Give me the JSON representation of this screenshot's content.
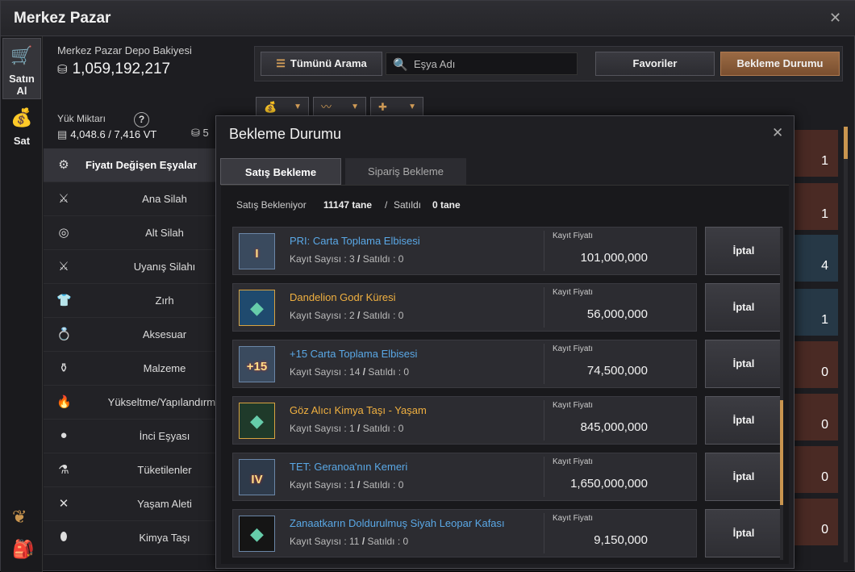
{
  "window": {
    "title": "Merkez Pazar"
  },
  "vtabs": [
    {
      "label": "Satın Al",
      "icon": "cart-icon"
    },
    {
      "label": "Sat",
      "icon": "money-bag-icon"
    }
  ],
  "balance": {
    "caption": "Merkez Pazar Depo Bakiyesi",
    "value": "1,059,192,217"
  },
  "load": {
    "caption": "Yük Miktarı",
    "current": "4,048.6",
    "separator": "/",
    "max": "7,416 VT",
    "help": "?",
    "partial": "5"
  },
  "categories": [
    {
      "label": "Fiyatı Değişen Eşyalar",
      "icon": "gear-icon",
      "glyph": "⚙"
    },
    {
      "label": "Ana Silah",
      "icon": "sword-icon",
      "glyph": "⚔"
    },
    {
      "label": "Alt Silah",
      "icon": "shield-icon",
      "glyph": "◎"
    },
    {
      "label": "Uyanış Silahı",
      "icon": "blade-icon",
      "glyph": "⚔"
    },
    {
      "label": "Zırh",
      "icon": "armor-icon",
      "glyph": "👕"
    },
    {
      "label": "Aksesuar",
      "icon": "ring-icon",
      "glyph": "💍"
    },
    {
      "label": "Malzeme",
      "icon": "material-icon",
      "glyph": "⚱"
    },
    {
      "label": "Yükseltme/Yapılandırma",
      "icon": "flame-icon",
      "glyph": "🔥"
    },
    {
      "label": "İnci Eşyası",
      "icon": "pearl-icon",
      "glyph": "●"
    },
    {
      "label": "Tüketilenler",
      "icon": "potion-icon",
      "glyph": "⚗"
    },
    {
      "label": "Yaşam Aleti",
      "icon": "tools-icon",
      "glyph": "✕"
    },
    {
      "label": "Kimya Taşı",
      "icon": "stone-icon",
      "glyph": "⬮"
    }
  ],
  "topbar": {
    "search_all": "Tümünü Arama",
    "search_placeholder": "Eşya Adı",
    "favorites": "Favoriler",
    "waiting": "Bekleme Durumu"
  },
  "right_counts": [
    "1",
    "1",
    "4",
    "1",
    "0",
    "0",
    "0",
    "0"
  ],
  "modal": {
    "title": "Bekleme Durumu",
    "tabs": [
      "Satış Bekleme",
      "Sipariş Bekleme"
    ],
    "summary": {
      "pending_label": "Satış Bekleniyor",
      "pending_value": "11147 tane",
      "slash": "/",
      "sold_label": "Satıldı",
      "sold_value": "0 tane"
    },
    "price_label": "Kayıt Fiyatı",
    "cancel_label": "İptal",
    "items": [
      {
        "name": "PRI: Carta Toplama Elbisesi",
        "name_color": "#5aa8e6",
        "count_label": "Kayıt Sayısı : 3",
        "sold_label": "Satıldı : 0",
        "price": "101,000,000",
        "badge": "I",
        "icon_bg": "#3a4a5e",
        "icon_border": "#6b87a8",
        "icon": "outfit-icon"
      },
      {
        "name": "Dandelion Godr Küresi",
        "name_color": "#f0b040",
        "count_label": "Kayıt Sayısı : 2",
        "sold_label": "Satıldı : 0",
        "price": "56,000,000",
        "badge": "",
        "icon_bg": "#1f4a6e",
        "icon_border": "#d8a340",
        "icon": "orb-icon"
      },
      {
        "name": "+15 Carta Toplama Elbisesi",
        "name_color": "#5aa8e6",
        "count_label": "Kayıt Sayısı : 14",
        "sold_label": "Satıldı : 0",
        "price": "74,500,000",
        "badge": "+15",
        "icon_bg": "#3a4a5e",
        "icon_border": "#6b87a8",
        "icon": "outfit-icon"
      },
      {
        "name": "Göz Alıcı Kimya Taşı - Yaşam",
        "name_color": "#f0b040",
        "count_label": "Kayıt Sayısı : 1",
        "sold_label": "Satıldı : 0",
        "price": "845,000,000",
        "badge": "",
        "icon_bg": "#1f3a2a",
        "icon_border": "#d8a340",
        "icon": "gem-icon"
      },
      {
        "name": "TET: Geranoa'nın Kemeri",
        "name_color": "#5aa8e6",
        "count_label": "Kayıt Sayısı : 1",
        "sold_label": "Satıldı : 0",
        "price": "1,650,000,000",
        "badge": "IV",
        "icon_bg": "#2e3a4a",
        "icon_border": "#6b87a8",
        "icon": "belt-icon"
      },
      {
        "name": "Zanaatkarın Doldurulmuş Siyah Leopar Kafası",
        "name_color": "#5aa8e6",
        "count_label": "Kayıt Sayısı : 11",
        "sold_label": "Satıldı : 0",
        "price": "9,150,000",
        "badge": "",
        "icon_bg": "#151515",
        "icon_border": "#6b87a8",
        "icon": "leopard-head-icon"
      }
    ]
  },
  "colors": {
    "accent": "#c9954f",
    "active_btn": "#8a5a38",
    "blue_name": "#5aa8e6",
    "gold_name": "#f0b040"
  }
}
